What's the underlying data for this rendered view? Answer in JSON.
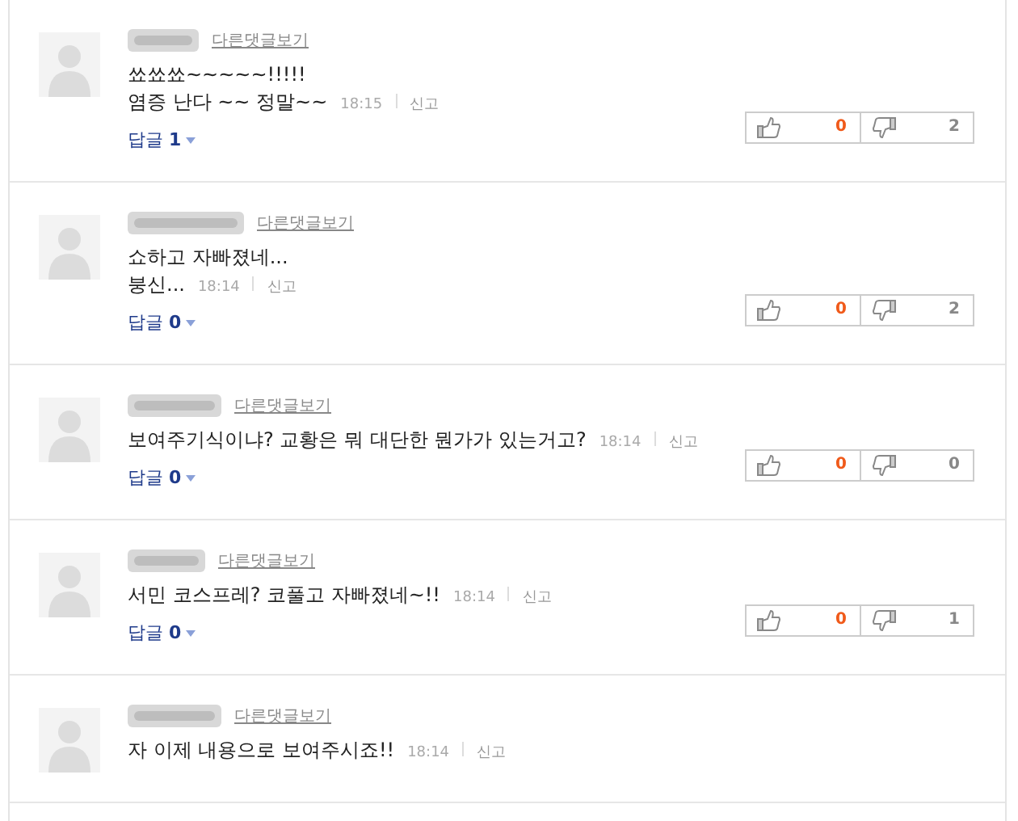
{
  "comments": [
    {
      "other_comments_link": "다른댓글보기",
      "lines": [
        "쑈쑈쑈~~~~~!!!!!",
        "염증 난다 ~~ 정말~~"
      ],
      "time": "18:15",
      "report": "신고",
      "reply_label": "답글",
      "reply_count": "1",
      "likes": "0",
      "dislikes": "2"
    },
    {
      "other_comments_link": "다른댓글보기",
      "lines": [
        "쇼하고 자빠졌네...",
        "붕신..."
      ],
      "time": "18:14",
      "report": "신고",
      "reply_label": "답글",
      "reply_count": "0",
      "likes": "0",
      "dislikes": "2"
    },
    {
      "other_comments_link": "다른댓글보기",
      "lines": [
        "보여주기식이냐? 교황은 뭐 대단한 뭔가가 있는거고?"
      ],
      "time": "18:14",
      "report": "신고",
      "reply_label": "답글",
      "reply_count": "0",
      "likes": "0",
      "dislikes": "0"
    },
    {
      "other_comments_link": "다른댓글보기",
      "lines": [
        "서민 코스프레? 코풀고 자빠졌네~!!"
      ],
      "time": "18:14",
      "report": "신고",
      "reply_label": "답글",
      "reply_count": "0",
      "likes": "0",
      "dislikes": "1"
    },
    {
      "other_comments_link": "다른댓글보기",
      "lines": [
        "자 이제 내용으로 보여주시죠!!"
      ],
      "time": "18:14",
      "report": "신고"
    }
  ]
}
